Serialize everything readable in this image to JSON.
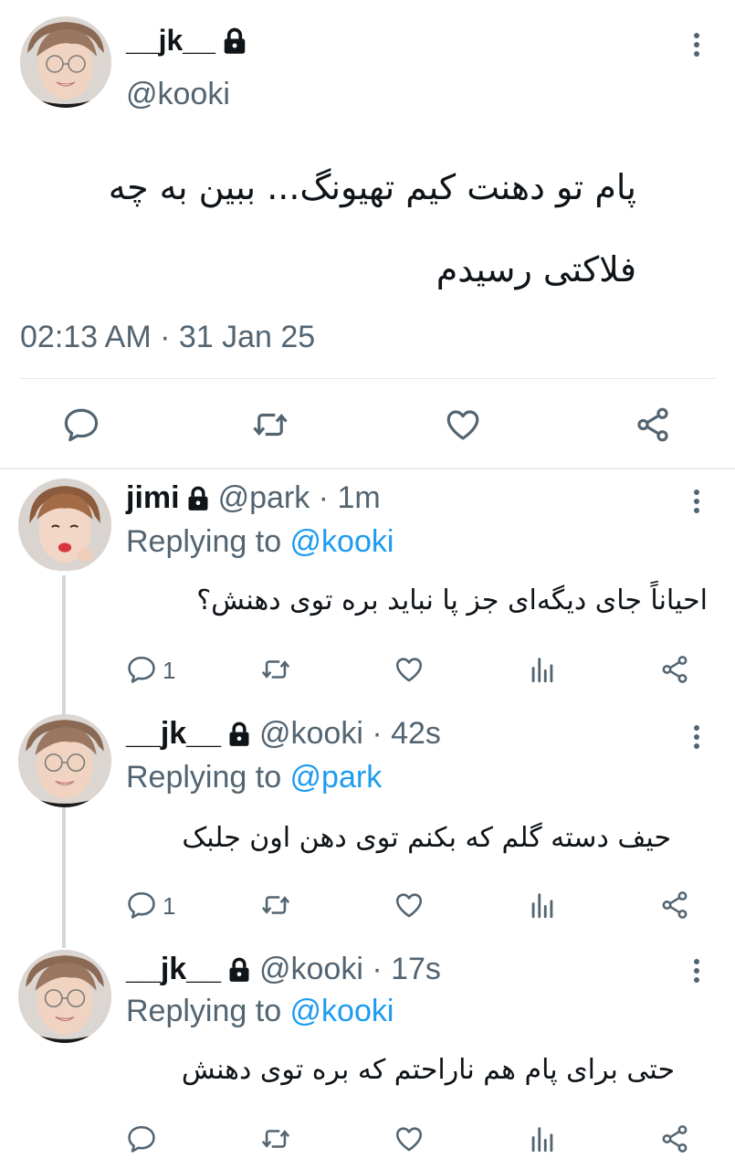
{
  "main_tweet": {
    "display_name": "__jk__",
    "handle": "@kooki",
    "text": "پام تو دهنت کیم تهیونگ... ببین به چه فلاکتی رسیدم",
    "timestamp": "02:13 AM · 31 Jan 25",
    "actions": [
      "reply-icon",
      "retweet-icon",
      "like-icon",
      "share-icon"
    ]
  },
  "replies": [
    {
      "display_name": "jimi",
      "handle": "@park · 1m",
      "replying_prefix": "Replying to ",
      "replying_to": "@kooki",
      "text": "احیاناً جای دیگه‌ای جز پا نباید بره توی دهنش؟",
      "reply_count": "1"
    },
    {
      "display_name": "__jk__",
      "handle": "@kooki · 42s",
      "replying_prefix": "Replying to ",
      "replying_to": "@park",
      "text": "حیف دسته گلم که بکنم توی دهن اون جلبک",
      "reply_count": "1"
    },
    {
      "display_name": "__jk__",
      "handle": "@kooki · 17s",
      "replying_prefix": "Replying to ",
      "replying_to": "@kooki",
      "text": "حتی برای پام هم ناراحتم که بره توی دهنش",
      "reply_count": ""
    }
  ],
  "colors": {
    "link": "#1d9bf0",
    "secondary_text": "#536471",
    "primary_text": "#0f1419",
    "thread_line": "#cfd9de"
  }
}
